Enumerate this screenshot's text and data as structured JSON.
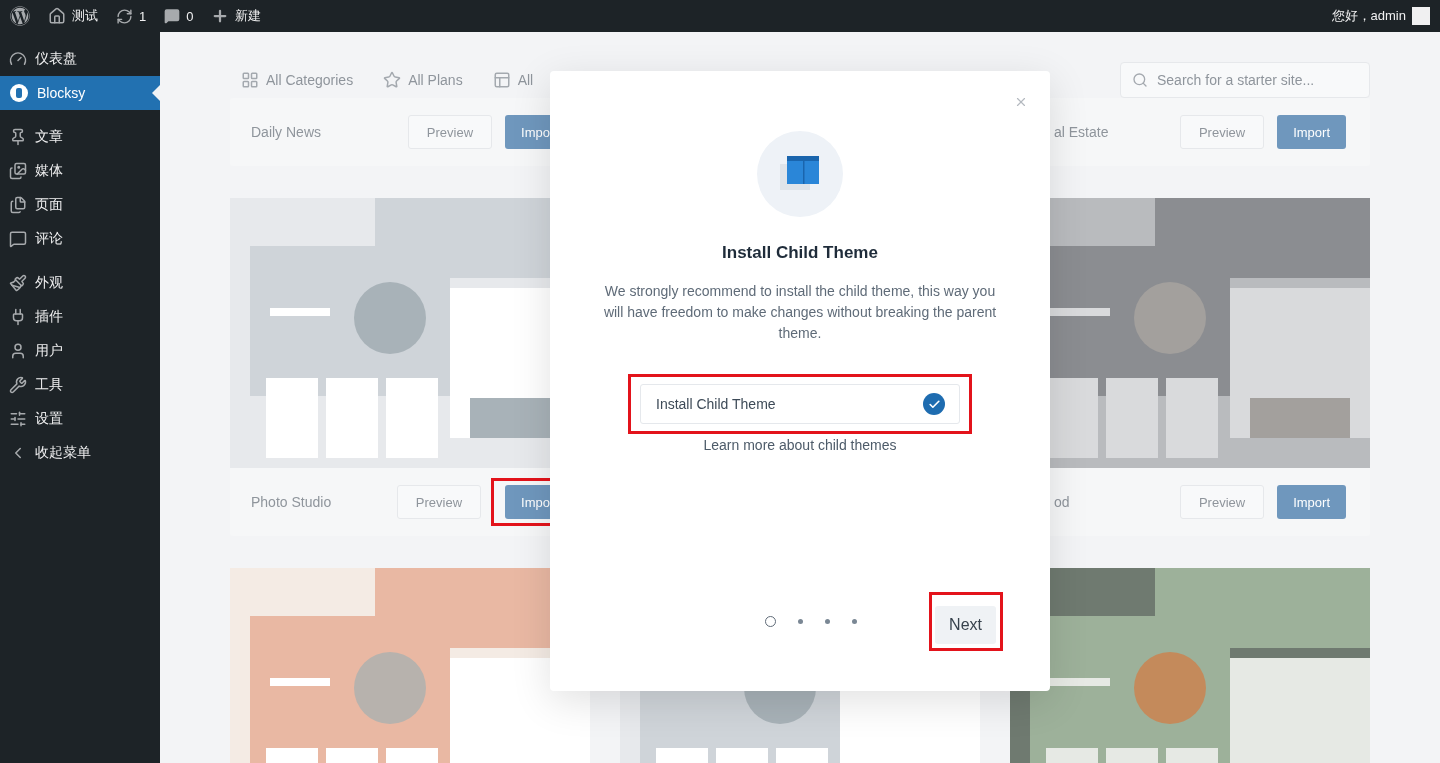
{
  "admin_bar": {
    "site": "测试",
    "updates": "1",
    "comments": "0",
    "new": "新建",
    "greeting": "您好，admin"
  },
  "sidebar": {
    "sections": [
      {
        "items": [
          {
            "label": "仪表盘",
            "selected": false
          },
          {
            "label": "Blocksy",
            "selected": true
          }
        ]
      },
      {
        "items": [
          {
            "label": "文章",
            "selected": false
          },
          {
            "label": "媒体",
            "selected": false
          },
          {
            "label": "页面",
            "selected": false
          },
          {
            "label": "评论",
            "selected": false
          }
        ]
      },
      {
        "items": [
          {
            "label": "外观",
            "selected": false
          },
          {
            "label": "插件",
            "selected": false
          },
          {
            "label": "用户",
            "selected": false
          },
          {
            "label": "工具",
            "selected": false
          },
          {
            "label": "设置",
            "selected": false
          },
          {
            "label": "收起菜单",
            "selected": false
          }
        ]
      }
    ]
  },
  "filters": [
    {
      "label": "All Categories"
    },
    {
      "label": "All Plans"
    },
    {
      "label": "All"
    }
  ],
  "search": {
    "placeholder": "Search for a starter site..."
  },
  "rows": [
    [
      {
        "kind": "footer",
        "title": "Daily News",
        "preview": "Preview",
        "import": "Impo",
        "highlighted": false
      },
      {
        "kind": "covered"
      },
      {
        "kind": "footer",
        "title": "al Estate",
        "preview": "Preview",
        "import": "Import",
        "highlighted": false
      }
    ],
    [
      {
        "kind": "card",
        "title": "Photo Studio",
        "preview": "Preview",
        "import": "Impo",
        "highlighted": true
      },
      {
        "kind": "covered"
      },
      {
        "kind": "card",
        "title": "od",
        "preview": "Preview",
        "import": "Import",
        "highlighted": false
      }
    ],
    [
      {
        "kind": "picture"
      },
      {
        "kind": "picture"
      },
      {
        "kind": "picture"
      }
    ]
  ],
  "modal": {
    "title": "Install Child Theme",
    "description": "We strongly recommend to install the child theme, this way you will have freedom to make changes without breaking the parent theme.",
    "option": {
      "label": "Install Child Theme",
      "checked": true,
      "highlighted": true
    },
    "link": "Learn more about child themes",
    "steps": [
      {
        "selected": true
      },
      {
        "selected": false
      },
      {
        "selected": false
      },
      {
        "selected": false
      }
    ],
    "next": {
      "label": "Next",
      "highlighted": true
    }
  }
}
